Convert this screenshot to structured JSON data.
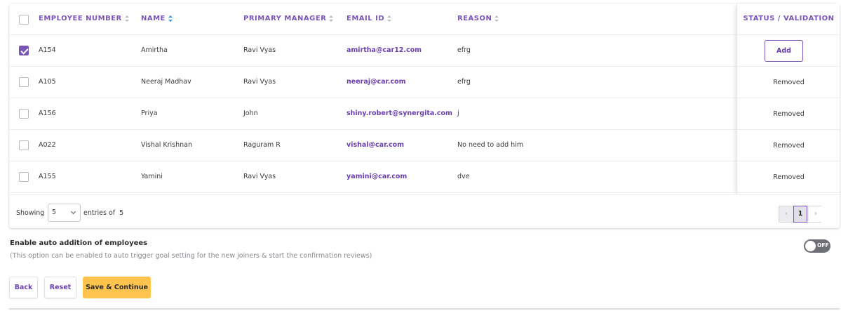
{
  "table": {
    "headers": {
      "employee_number": "EMPLOYEE NUMBER",
      "name": "NAME",
      "primary_manager": "PRIMARY MANAGER",
      "email_id": "EMAIL ID",
      "reason": "REASON",
      "status": "STATUS / VALIDATION"
    },
    "rows": [
      {
        "checked": true,
        "employee_number": "A154",
        "name": "Amirtha",
        "primary_manager": "Ravi Vyas",
        "email": "amirtha@car12.com",
        "reason": "efrg",
        "status": "Add"
      },
      {
        "checked": false,
        "employee_number": "A105",
        "name": "Neeraj Madhav",
        "primary_manager": "Ravi Vyas",
        "email": "neeraj@car.com",
        "reason": "efrg",
        "status": "Removed"
      },
      {
        "checked": false,
        "employee_number": "A156",
        "name": "Priya",
        "primary_manager": "John",
        "email": "shiny.robert@synergita.com",
        "reason": "j",
        "status": "Removed"
      },
      {
        "checked": false,
        "employee_number": "A022",
        "name": "Vishal Krishnan",
        "primary_manager": "Raguram R",
        "email": "vishal@car.com",
        "reason": "No need to add him",
        "status": "Removed"
      },
      {
        "checked": false,
        "employee_number": "A155",
        "name": "Yamini",
        "primary_manager": "Ravi Vyas",
        "email": "yamini@car.com",
        "reason": "dve",
        "status": "Removed"
      }
    ]
  },
  "footer": {
    "showing_label": "Showing",
    "page_size": "5",
    "entries_label": "entries of",
    "total": "5",
    "current_page": "1",
    "prev_glyph": "‹",
    "next_glyph": "›"
  },
  "auto_addition": {
    "title": "Enable auto addition of employees",
    "description": "(This option can be enabled to auto trigger goal setting for the new joiners & start the confirmation reviews)",
    "toggle_label": "OFF"
  },
  "actions": {
    "back": "Back",
    "reset": "Reset",
    "save": "Save & Continue"
  },
  "colors": {
    "accent": "#7a55b8",
    "primary_button": "#ffc44d",
    "sort_active": "#2f8ee0"
  }
}
